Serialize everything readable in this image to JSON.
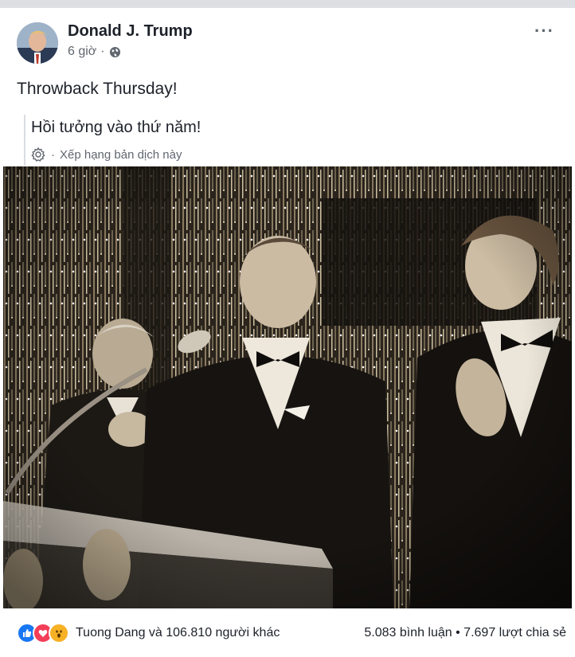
{
  "post": {
    "author": "Donald J. Trump",
    "time": "6 giờ",
    "separator": "·",
    "text": "Throwback Thursday!",
    "translation": "Hồi tưởng vào thứ năm!",
    "rate_translation": "Xếp hạng bản dịch này",
    "rate_separator": "·",
    "more_label": "···"
  },
  "reactions": {
    "icons": [
      "like-icon",
      "love-icon",
      "wow-icon"
    ],
    "likers": "Tuong Dang và 106.810 người khác",
    "comments": "5.083 bình luận",
    "shares": "7.697 lượt chia sẻ",
    "stats_separator": " • "
  },
  "colors": {
    "like": "#1877f2",
    "love": "#f33e58",
    "wow": "#f7b125",
    "meta": "#606770"
  }
}
